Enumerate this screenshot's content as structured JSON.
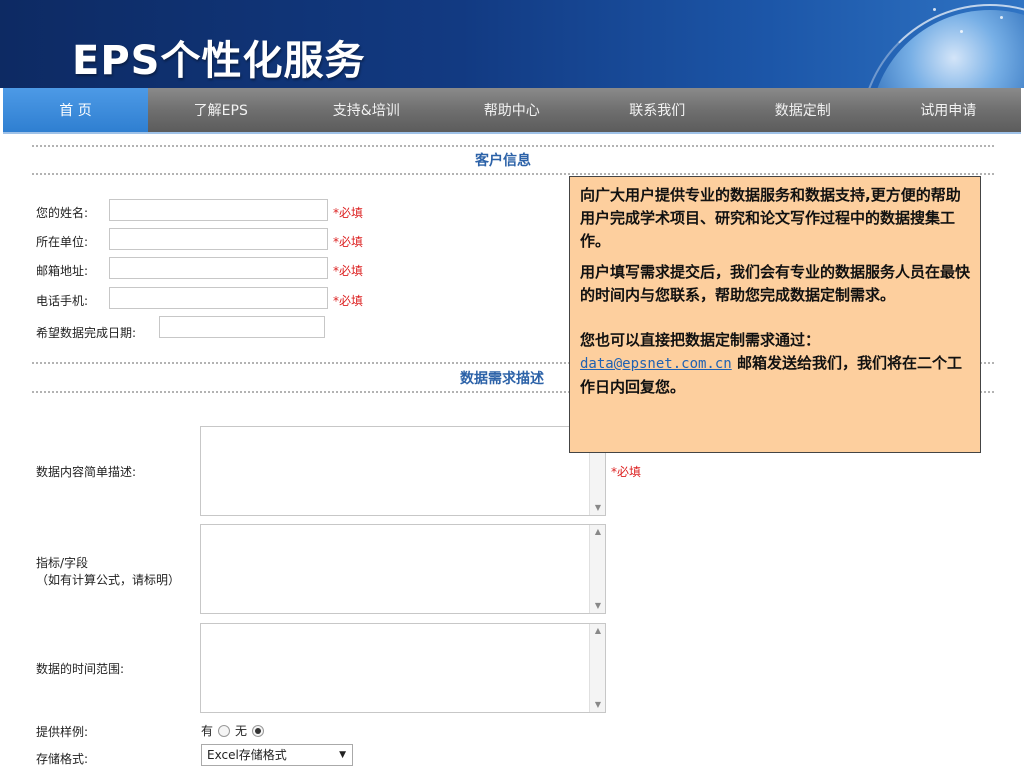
{
  "header": {
    "title": "EPS个性化服务"
  },
  "nav": {
    "items": [
      {
        "label": "首  页",
        "active": true
      },
      {
        "label": "了解EPS",
        "active": false
      },
      {
        "label": "支持&培训",
        "active": false
      },
      {
        "label": "帮助中心",
        "active": false
      },
      {
        "label": "联系我们",
        "active": false
      },
      {
        "label": "数据定制",
        "active": false
      },
      {
        "label": "试用申请",
        "active": false
      }
    ]
  },
  "customer": {
    "section_title": "客户信息",
    "required_mark": "*必填",
    "fields": [
      {
        "label": "您的姓名:",
        "value": ""
      },
      {
        "label": "所在单位:",
        "value": ""
      },
      {
        "label": "邮箱地址:",
        "value": ""
      },
      {
        "label": "电话手机:",
        "value": ""
      },
      {
        "label": "希望数据完成日期:",
        "value": ""
      }
    ]
  },
  "demand": {
    "section_title": "数据需求描述",
    "required_mark": "*必填",
    "content_label": "数据内容简单描述:",
    "indicator_label": "指标/字段",
    "indicator_note": "（如有计算公式，请标明）",
    "time_label": "数据的时间范围:",
    "sample_label": "提供样例:",
    "sample_yes": "有",
    "sample_no": "无",
    "storage_label": "存储格式:",
    "storage_selected": "Excel存储格式"
  },
  "info": {
    "p1": "向广大用户提供专业的数据服务和数据支持,更方便的帮助用户完成学术项目、研究和论文写作过程中的数据搜集工作。",
    "p2": "用户填写需求提交后，我们会有专业的数据服务人员在最快的时间内与您联系，帮助您完成数据定制需求。",
    "p3_prefix": "您也可以直接把数据定制需求通过：",
    "email": "data@epsnet.com.cn",
    "p3_suffix": " 邮箱发送给我们，我们将在二个工作日内回复您。"
  },
  "colors": {
    "nav_active": "#3a8ad9",
    "info_bg": "#fdcf9e",
    "required": "#dd2222",
    "section_title": "#2c62a8"
  }
}
